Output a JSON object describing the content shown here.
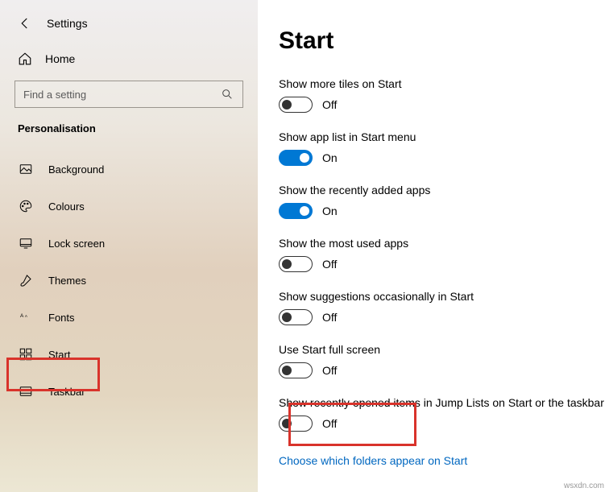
{
  "app_title": "Settings",
  "home_label": "Home",
  "search_placeholder": "Find a setting",
  "category_title": "Personalisation",
  "sidebar": {
    "items": [
      {
        "label": "Background"
      },
      {
        "label": "Colours"
      },
      {
        "label": "Lock screen"
      },
      {
        "label": "Themes"
      },
      {
        "label": "Fonts"
      },
      {
        "label": "Start"
      },
      {
        "label": "Taskbar"
      }
    ]
  },
  "page": {
    "heading": "Start",
    "toggle_on": "On",
    "toggle_off": "Off",
    "options": [
      {
        "label": "Show more tiles on Start",
        "on": false
      },
      {
        "label": "Show app list in Start menu",
        "on": true
      },
      {
        "label": "Show the recently added apps",
        "on": true
      },
      {
        "label": "Show the most used apps",
        "on": false
      },
      {
        "label": "Show suggestions occasionally in Start",
        "on": false
      },
      {
        "label": "Use Start full screen",
        "on": false
      },
      {
        "label": "Show recently opened items in Jump Lists on Start or the taskbar",
        "on": false
      }
    ],
    "link": "Choose which folders appear on Start"
  },
  "watermark": "wsxdn.com"
}
